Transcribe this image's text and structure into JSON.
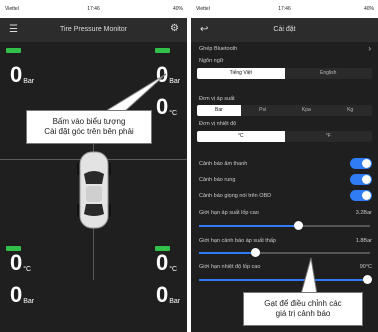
{
  "status_bar": {
    "carrier": "Viettel",
    "time": "17:46",
    "battery": "40%"
  },
  "left_screen": {
    "title": "Tire Pressure Monitor",
    "front_left": {
      "value": "0",
      "unit": "Bar"
    },
    "front_right": {
      "value": "0",
      "unit": "Bar"
    },
    "front_right_temp": {
      "value": "0",
      "unit": "°C"
    },
    "rear_left_temp": {
      "value": "0",
      "unit": "°C"
    },
    "rear_left": {
      "value": "0",
      "unit": "Bar"
    },
    "rear_right_temp": {
      "value": "0",
      "unit": "°C"
    },
    "rear_right": {
      "value": "0",
      "unit": "Bar"
    },
    "callout": {
      "line1": "Bấm vào biểu tượng",
      "line2": "Cài đặt góc trên bên phải"
    }
  },
  "right_screen": {
    "title": "Cài đặt",
    "bluetooth": "Ghép Bluetooth",
    "language_label": "Ngôn ngữ",
    "language_options": [
      "Tiếng Việt",
      "English"
    ],
    "language_selected": "Tiếng Việt",
    "pressure_unit_label": "Đơn vị áp suất",
    "pressure_units": [
      "Bar",
      "Psi",
      "Kpa",
      "Kg"
    ],
    "pressure_unit_selected": "Bar",
    "temp_unit_label": "Đơn vị nhiệt độ",
    "temp_units": [
      "°C",
      "°F"
    ],
    "temp_unit_selected": "°C",
    "toggles": [
      {
        "label": "Cảnh báo âm thanh",
        "on": true
      },
      {
        "label": "Cảnh báo rung",
        "on": true
      },
      {
        "label": "Cảnh báo giọng nói trên OBD",
        "on": true
      }
    ],
    "sliders": [
      {
        "label": "Giới hạn áp suất lốp cao",
        "value_text": "3.2Bar",
        "level": 0.58
      },
      {
        "label": "Giới hạn cảnh báo áp suất thấp",
        "value_text": "1.8Bar",
        "level": 0.33
      },
      {
        "label": "Giới hạn nhiệt độ lốp cao",
        "value_text": "90°C",
        "level": 0.98
      }
    ],
    "callout": {
      "line1": "Gạt để điều chỉnh các",
      "line2": "giá trị cảnh báo"
    }
  },
  "colors": {
    "accent": "#2f7cf4",
    "battery": "#32c04a",
    "background": "#1f1f1f"
  }
}
